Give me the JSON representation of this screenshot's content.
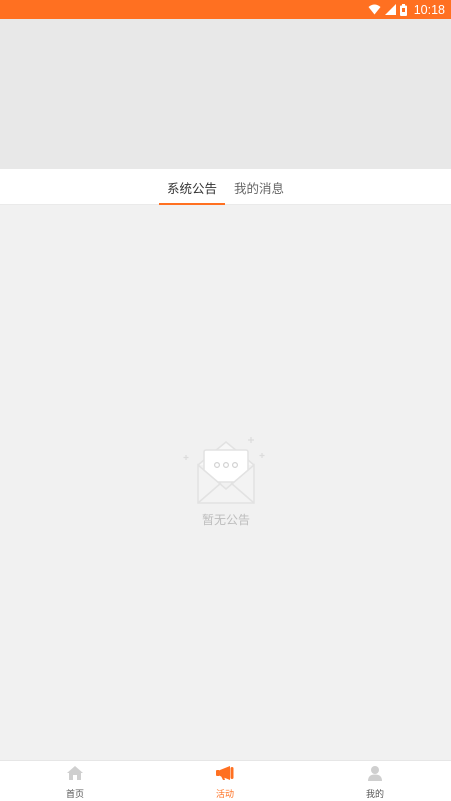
{
  "status_bar": {
    "time": "10:18",
    "icons": [
      "wifi-icon",
      "signal-icon",
      "battery-icon"
    ]
  },
  "tabs": {
    "items": [
      {
        "label": "系统公告",
        "active": true
      },
      {
        "label": "我的消息",
        "active": false
      }
    ]
  },
  "empty_state": {
    "icon": "envelope-icon",
    "text": "暂无公告"
  },
  "bottom_nav": {
    "items": [
      {
        "label": "首页",
        "icon": "home-icon",
        "active": false
      },
      {
        "label": "活动",
        "icon": "megaphone-icon",
        "active": true
      },
      {
        "label": "我的",
        "icon": "user-icon",
        "active": false
      }
    ]
  },
  "colors": {
    "accent": "#ff7021",
    "banner": "#e8e8e8",
    "background": "#f1f1f1"
  }
}
